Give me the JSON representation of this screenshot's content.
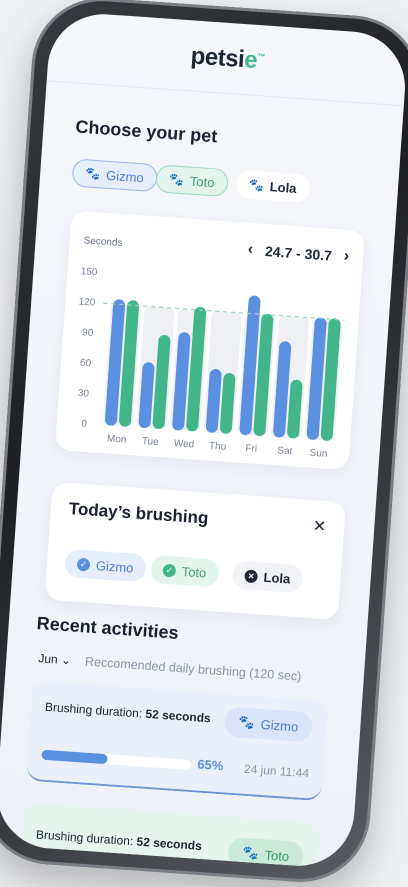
{
  "app": {
    "brand_main": "petsi",
    "brand_accent": "e",
    "brand_mark": "™"
  },
  "choose_pet": {
    "title": "Choose your pet",
    "pets": [
      {
        "name": "Gizmo",
        "state": "selected",
        "color": "#5b8fe0"
      },
      {
        "name": "Toto",
        "state": "selected",
        "color": "#43b58a"
      },
      {
        "name": "Lola",
        "state": "unselected",
        "color": "#1d2433"
      }
    ]
  },
  "chart_data": {
    "type": "bar",
    "ylabel": "Seconds",
    "ylim": [
      0,
      150
    ],
    "yticks": [
      0,
      30,
      60,
      90,
      120,
      150
    ],
    "reference_line": 120,
    "range_label": "24.7 - 30.7",
    "categories": [
      "Mon",
      "Tue",
      "Wed",
      "Thu",
      "Fri",
      "Sat",
      "Sun"
    ],
    "series": [
      {
        "values": [
          125,
          65,
          97,
          63,
          138,
          95,
          121
        ],
        "color": "#5b8fe0"
      },
      {
        "values": [
          125,
          93,
          123,
          60,
          121,
          58,
          121
        ],
        "color": "#43b58a"
      }
    ],
    "target_band": [
      120,
      120,
      120,
      120,
      120,
      120,
      120
    ]
  },
  "today": {
    "title": "Today’s brushing",
    "close_icon": "close-icon",
    "pets": [
      {
        "name": "Gizmo",
        "done": true
      },
      {
        "name": "Toto",
        "done": true
      },
      {
        "name": "Lola",
        "done": false
      }
    ]
  },
  "recent": {
    "title": "Recent activities",
    "month": "Jun",
    "hint": "Reccomended daily brushing (120 sec)",
    "items": [
      {
        "label": "Brushing duration:",
        "duration": "52 seconds",
        "pet": "Gizmo",
        "percent_text": "65%",
        "percent": 0.44,
        "time": "24 jun 11:44"
      },
      {
        "label": "Brushing duration:",
        "duration": "52 seconds",
        "pet": "Toto"
      }
    ]
  }
}
